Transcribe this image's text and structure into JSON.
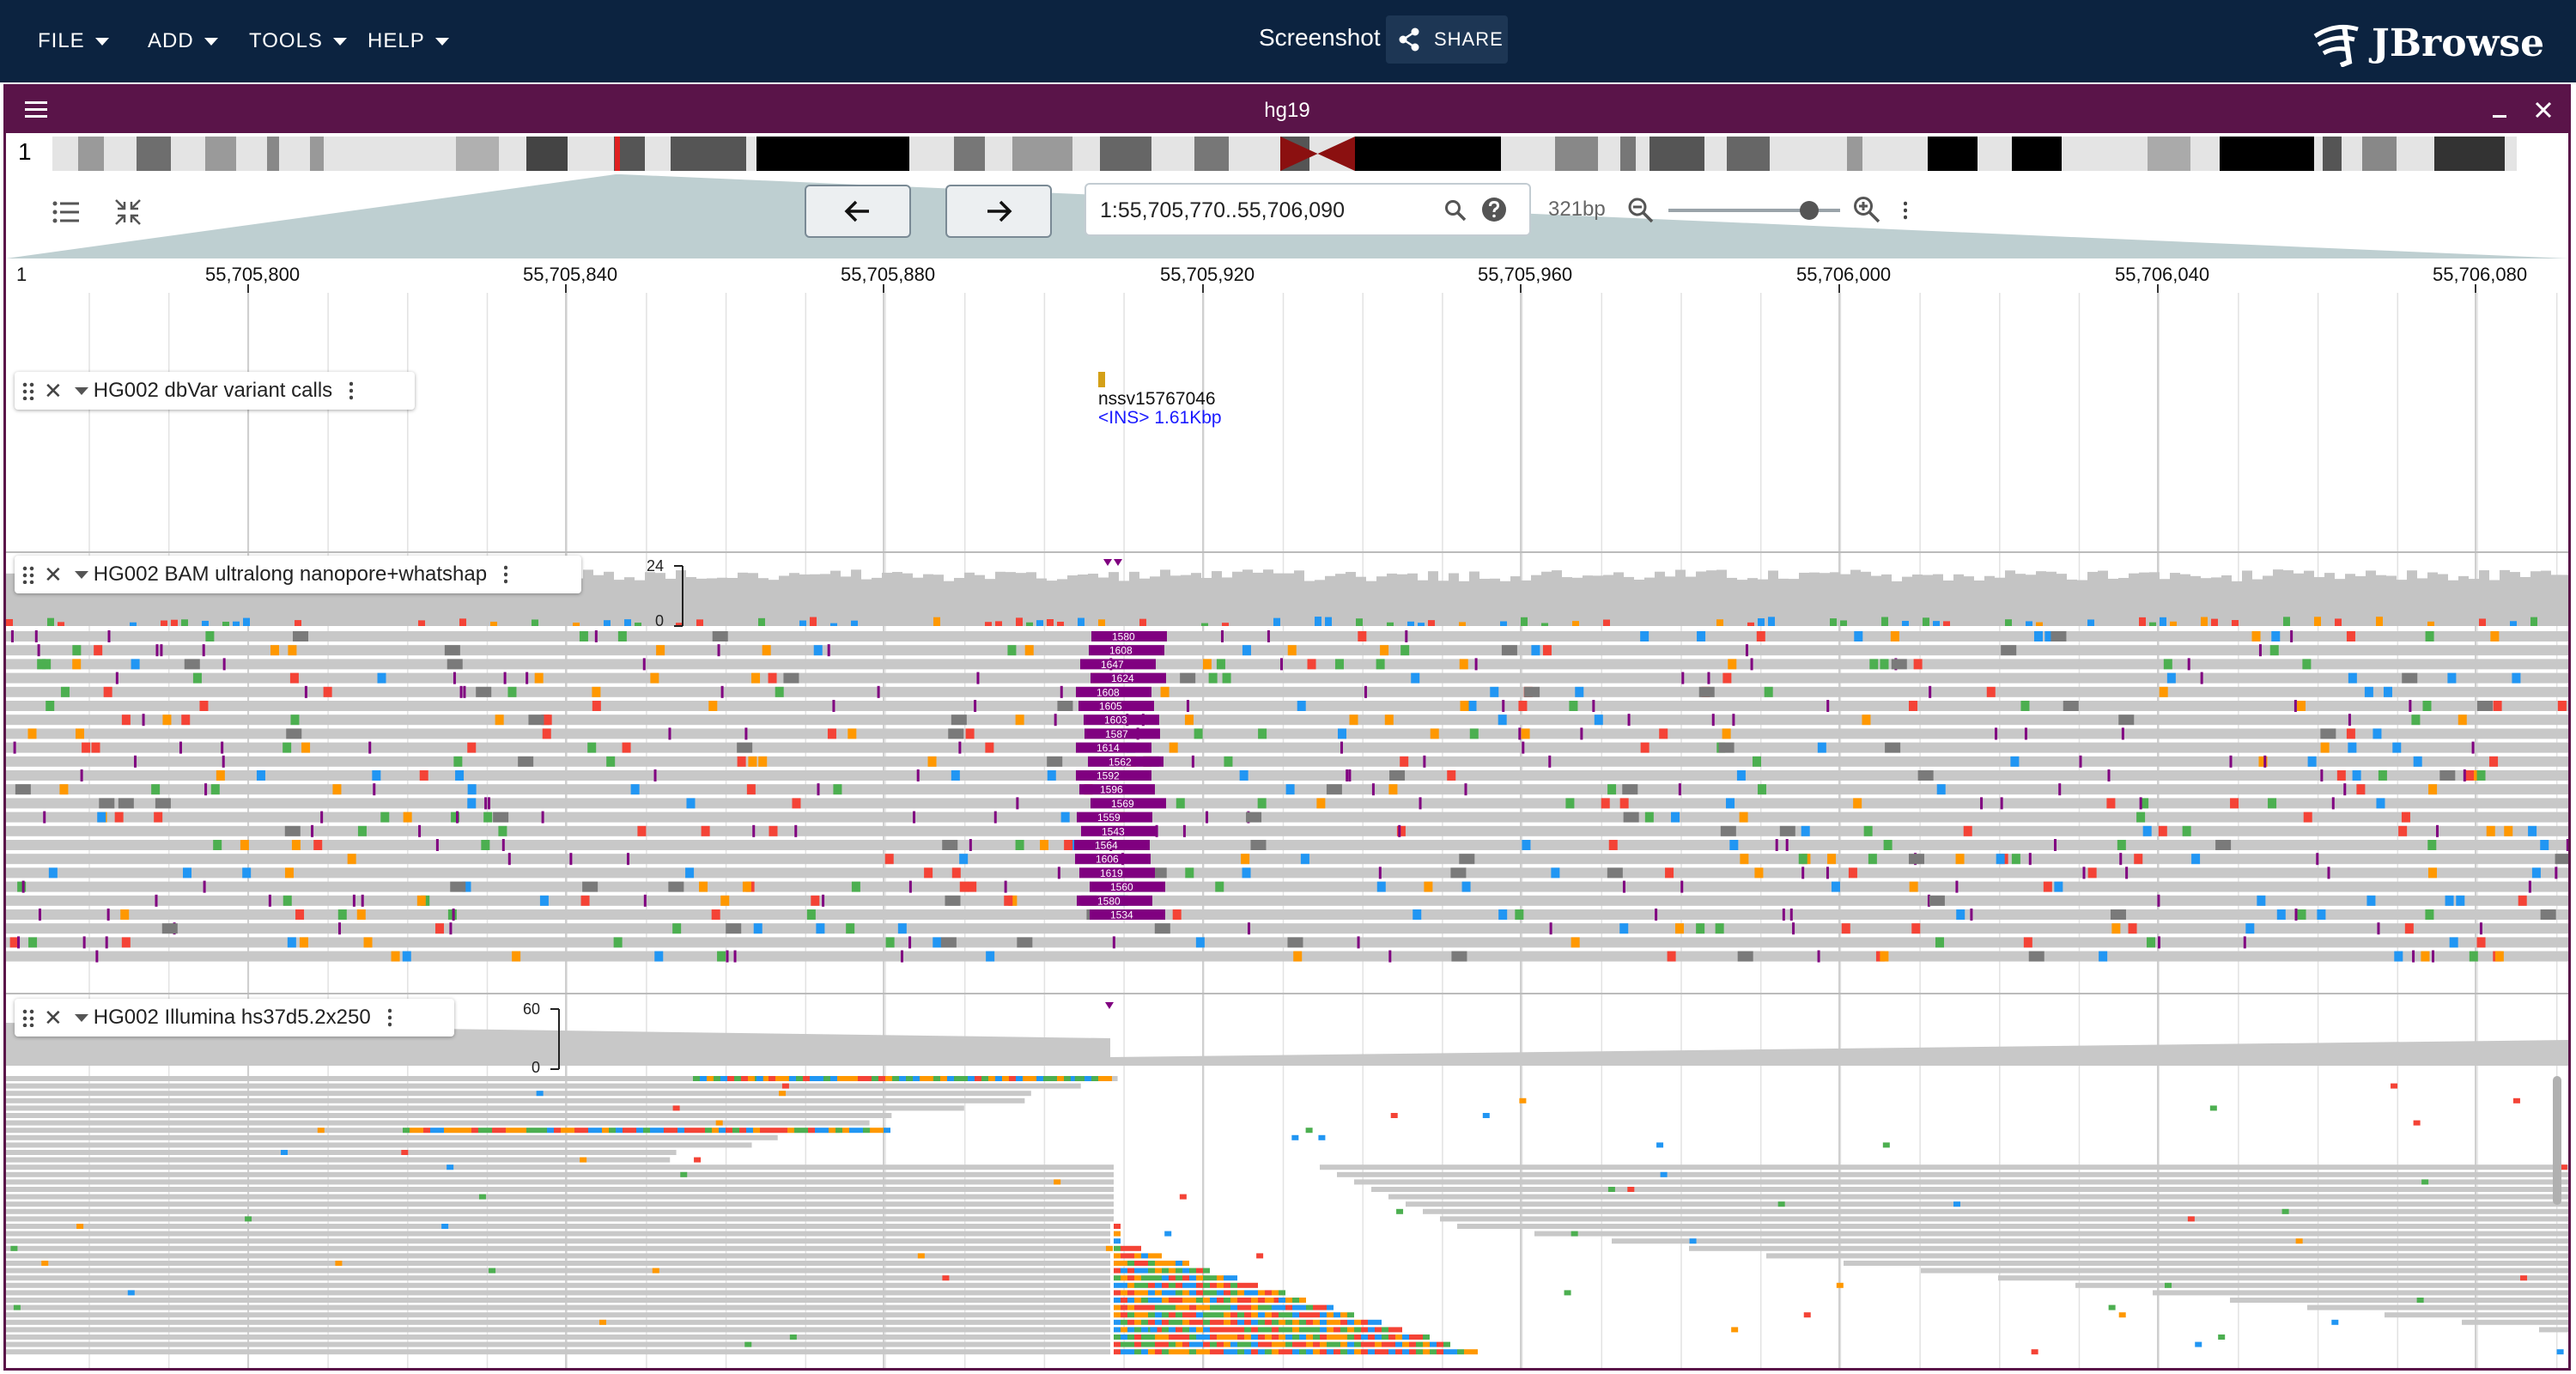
{
  "menu": {
    "items": [
      "FILE",
      "ADD",
      "TOOLS",
      "HELP"
    ],
    "file": "FILE",
    "add": "ADD",
    "tools": "TOOLS",
    "help": "HELP"
  },
  "session": {
    "title": "Screenshot"
  },
  "share": {
    "label": "SHARE"
  },
  "logo": {
    "text": "JBrowse"
  },
  "view": {
    "title": "hg19"
  },
  "ideogram": {
    "chromosome": "1"
  },
  "navigation": {
    "location": "1:55,705,770..55,706,090",
    "bp_width": "321bp",
    "zoom_level": 0.82
  },
  "ruler": {
    "region_label": "1",
    "ticks": [
      "55,705,800",
      "55,705,840",
      "55,705,880",
      "55,705,920",
      "55,705,960",
      "55,706,000",
      "55,706,040",
      "55,706,080"
    ]
  },
  "tracks": {
    "variants": {
      "name": "HG002 dbVar variant calls",
      "feature_name": "nssv15767046",
      "feature_desc": "<INS> 1.61Kbp"
    },
    "nanopore": {
      "name": "HG002 BAM ultralong nanopore+whatshap",
      "coverage_max": "24",
      "coverage_min": "0",
      "insertion_labels": [
        "1580",
        "1608",
        "1647",
        "1624",
        "1608",
        "1605",
        "1603",
        "1587",
        "1614",
        "1562",
        "1592",
        "1596",
        "1569",
        "1559",
        "1543",
        "1564",
        "1606",
        "1619",
        "1560",
        "1580",
        "1534"
      ]
    },
    "illumina": {
      "name": "HG002 Illumina hs37d5.2x250",
      "coverage_max": "60",
      "coverage_min": "0"
    }
  },
  "colors": {
    "header": "#0c2340",
    "view_border": "#5a1449",
    "insertion": "#800080",
    "base_A": "#4caf50",
    "base_C": "#2196f3",
    "base_G": "#ff9800",
    "base_T": "#f44336",
    "read": "#c8c8c8"
  }
}
